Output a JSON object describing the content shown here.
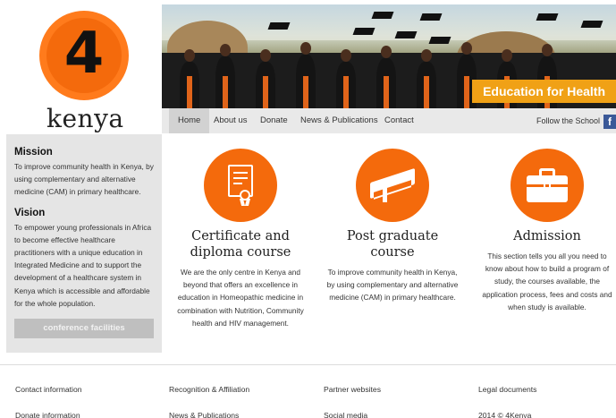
{
  "logo": {
    "number": "4",
    "text": "kenya"
  },
  "banner": {
    "tagline": "Education for Health"
  },
  "nav": {
    "items": [
      {
        "label": "Home",
        "active": true
      },
      {
        "label": "About us"
      },
      {
        "label": "Donate"
      },
      {
        "label": "News & Publications"
      },
      {
        "label": "Contact"
      }
    ],
    "follow_label": "Follow the School",
    "social_icon": "facebook-icon"
  },
  "sidebar": {
    "mission_title": "Mission",
    "mission_text": "To improve community health in Kenya, by using complementary and alternative medicine (CAM) in primary healthcare.",
    "vision_title": "Vision",
    "vision_text": "To empower young professionals in Africa to become effective healthcare practitioners with a unique education in Integrated Medicine and to support the development of a healthcare system in Kenya which is accessible and affordable for the whole population.",
    "button_label": "conference facilities"
  },
  "features": [
    {
      "icon": "certificate-icon",
      "title": "Certificate and diploma course",
      "text": "We are the only centre in Kenya and beyond that offers an excellence in education in Homeopathic medicine in combination with Nutrition, Community health and HIV management."
    },
    {
      "icon": "book-icon",
      "title": "Post graduate course",
      "text": "To improve community health in Kenya, by using complementary and alternative medicine (CAM) in primary healthcare."
    },
    {
      "icon": "briefcase-icon",
      "title": "Admission",
      "text": "This section tells you all you need to know about how to build a program of study, the courses available, the application process, fees and costs and when study is available."
    }
  ],
  "footer": {
    "row1": [
      "Contact information",
      "Recognition & Affiliation",
      "Partner websites",
      "Legal documents"
    ],
    "row2": [
      "Donate information",
      "News & Publications",
      "Social media",
      "2014 © 4Kenya"
    ]
  },
  "colors": {
    "accent": "#f46a0c",
    "banner_tag": "#f0a116",
    "nav_bg": "#e9e9e9",
    "sidebar_bg": "#e5e5e5"
  }
}
